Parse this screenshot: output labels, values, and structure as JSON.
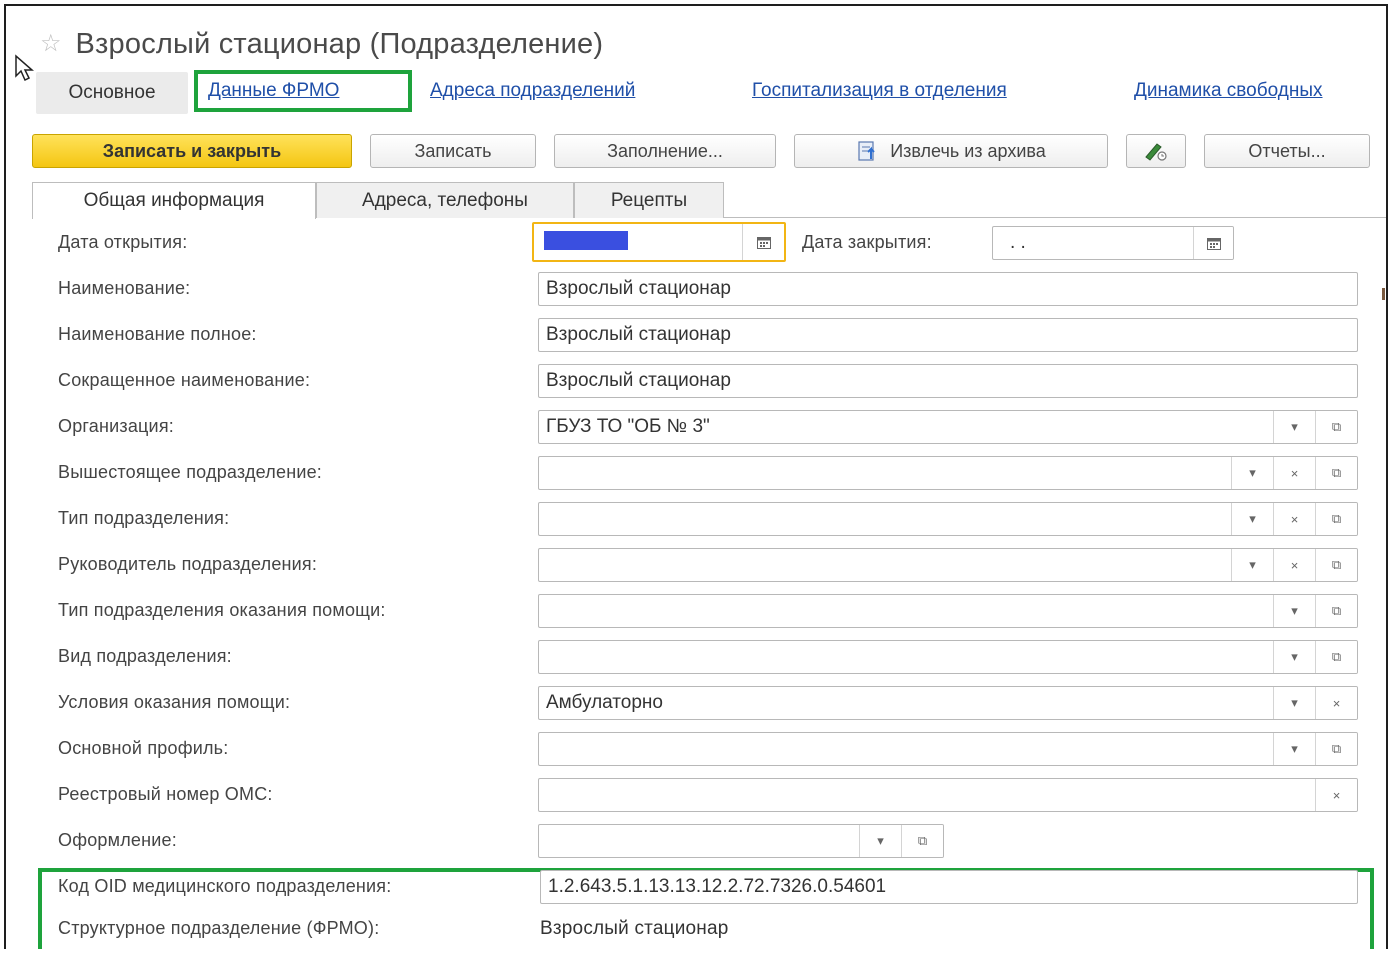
{
  "window": {
    "title": "Взрослый стационар (Подразделение)",
    "icons": {
      "favorite": "star-outline-icon",
      "cursor": "mouse-pointer-icon"
    }
  },
  "nav": {
    "items": [
      {
        "label": "Основное"
      },
      {
        "label": "Данные ФРМО"
      },
      {
        "label": "Адреса подразделений"
      },
      {
        "label": "Госпитализация в отделения"
      },
      {
        "label": "Динамика свободных"
      }
    ]
  },
  "toolbar": {
    "save_close": "Записать и закрыть",
    "save": "Записать",
    "fill": "Заполнение...",
    "extract": "Извлечь из архива",
    "reports": "Отчеты...",
    "icons": {
      "extract": "archive-extract-icon",
      "sign": "signature-pen-icon"
    }
  },
  "tabs": [
    {
      "label": "Общая информация"
    },
    {
      "label": "Адреса, телефоны"
    },
    {
      "label": "Рецепты"
    }
  ],
  "form": {
    "open_date_label": "Дата открытия:",
    "open_date_value": "",
    "close_date_label": "Дата закрытия:",
    "close_date_value": " .  .",
    "name_label": "Наименование:",
    "name_value": "Взрослый стационар",
    "full_name_label": "Наименование полное:",
    "full_name_value": "Взрослый стационар",
    "short_name_label": "Сокращенное наименование:",
    "short_name_value": "Взрослый стационар",
    "org_label": "Организация:",
    "org_value": "ГБУЗ ТО \"ОБ № 3\"",
    "parent_label": "Вышестоящее подразделение:",
    "parent_value": "",
    "type_label": "Тип подразделения:",
    "type_value": "",
    "head_label": "Руководитель подразделения:",
    "head_value": "",
    "care_type_label": "Тип подразделения оказания помощи:",
    "care_type_value": "",
    "kind_label": "Вид подразделения:",
    "kind_value": "",
    "conditions_label": "Условия оказания помощи:",
    "conditions_value": "Амбулаторно",
    "profile_label": "Основной профиль:",
    "profile_value": "",
    "oms_label": "Реестровый номер ОМС:",
    "oms_value": "",
    "design_label": "Оформление:",
    "design_value": "",
    "oid_label": "Код OID медицинского подразделения:",
    "oid_value": "1.2.643.5.1.13.13.12.2.72.7326.0.54601",
    "frmo_unit_label": "Структурное подразделение (ФРМО):",
    "frmo_unit_value": "Взрослый стационар"
  },
  "icons": {
    "calendar": "calendar-icon",
    "dropdown": "dropdown-arrow-icon",
    "clear": "clear-x-icon",
    "open": "open-window-icon"
  },
  "colors": {
    "highlight_frame": "#1ea33c",
    "primary_button": "#f4c612",
    "link": "#1f4fa8",
    "focus_border": "#f2b514",
    "selection": "#3a4fe0"
  }
}
